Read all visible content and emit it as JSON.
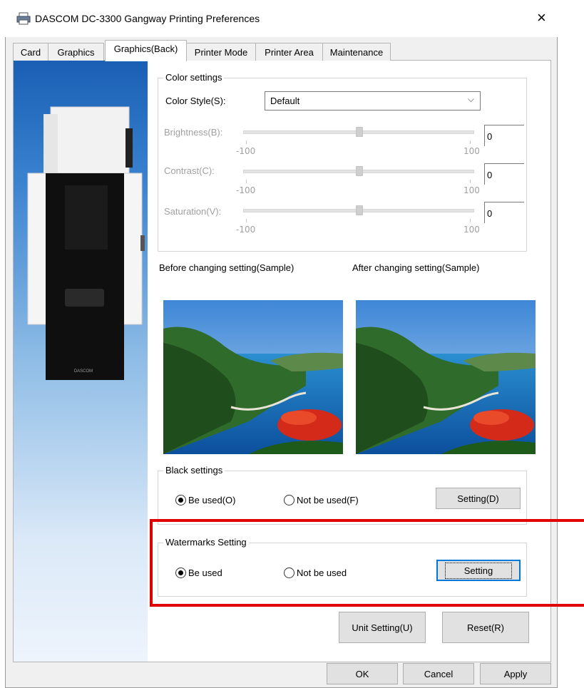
{
  "window": {
    "title": "DASCOM DC-3300 Gangway Printing Preferences",
    "close_glyph": "×"
  },
  "tabs": [
    {
      "label": "Card"
    },
    {
      "label": "Graphics"
    },
    {
      "label": "Graphics(Back)",
      "active": true
    },
    {
      "label": "Printer Mode"
    },
    {
      "label": "Printer Area"
    },
    {
      "label": "Maintenance"
    }
  ],
  "side_panel": {
    "printer_brand": "DASCOM"
  },
  "color_settings": {
    "title": "Color settings",
    "style_label": "Color Style(S):",
    "style_value": "Default",
    "sliders": [
      {
        "label": "Brightness(B):",
        "value": "0",
        "min": "-100",
        "max": "100"
      },
      {
        "label": "Contrast(C):",
        "value": "0",
        "min": "-100",
        "max": "100"
      },
      {
        "label": "Saturation(V):",
        "value": "0",
        "min": "-100",
        "max": "100"
      }
    ]
  },
  "samples": {
    "before_label": "Before changing setting(Sample)",
    "after_label": "After changing setting(Sample)"
  },
  "black_settings": {
    "title": "Black settings",
    "option_used": "Be used(O)",
    "option_not_used": "Not be used(F)",
    "selected": "used",
    "setting_button": "Setting(D)"
  },
  "watermarks": {
    "title": "Watermarks Setting",
    "option_used": "Be used",
    "option_not_used": "Not be used",
    "selected": "used",
    "setting_button": "Setting"
  },
  "actions": {
    "unit_setting": "Unit Setting(U)",
    "reset": "Reset(R)"
  },
  "footer": {
    "ok": "OK",
    "cancel": "Cancel",
    "apply": "Apply"
  },
  "colors": {
    "highlight": "#e00000",
    "focus": "#0078d7"
  }
}
